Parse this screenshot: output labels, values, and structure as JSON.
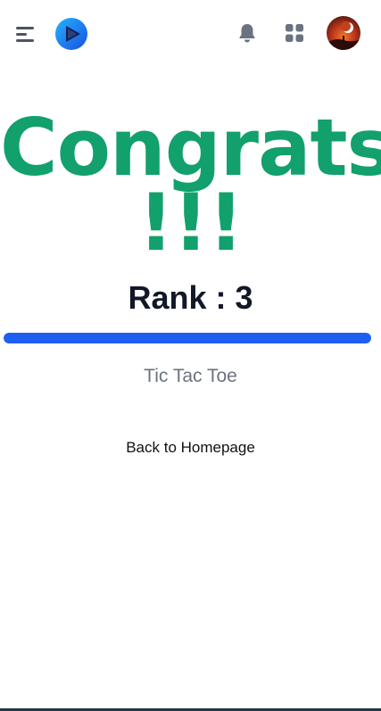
{
  "header": {
    "menu_icon": "hamburger-menu-icon",
    "logo_icon": "play-logo-icon",
    "notification_icon": "bell-icon",
    "apps_icon": "apps-grid-icon",
    "avatar_icon": "user-avatar"
  },
  "result": {
    "headline": "Congrats !!!",
    "rank_text": "Rank : 3",
    "progress_fraction": 1.0,
    "game_name": "Tic Tac Toe",
    "back_label": "Back to Homepage"
  },
  "colors": {
    "accent_green": "#12a06c",
    "progress_blue": "#1d5ff2",
    "icon_gray": "#6b7280",
    "text_dark": "#111827"
  }
}
